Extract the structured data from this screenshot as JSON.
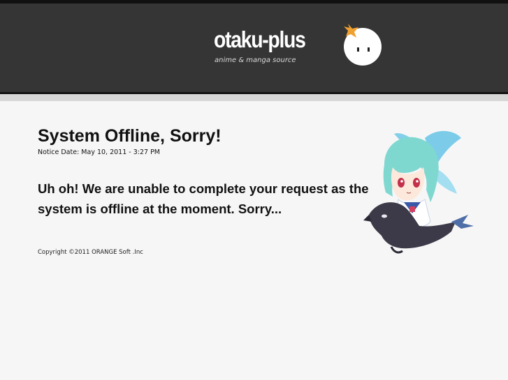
{
  "header": {
    "logo_text": "otaku-plus",
    "tagline": "anime & manga source",
    "mascot_icon": "blob-mascot-icon"
  },
  "notice": {
    "title": "System Offline, Sorry!",
    "date": "Notice Date: May 10, 2011 - 3:27 PM",
    "message": "Uh oh! We are unable to complete your request as the system is offline at the moment. Sorry..."
  },
  "footer": {
    "copyright": "Copyright ©2011 ORANGE Soft .Inc"
  },
  "illustration": {
    "icon": "anime-girl-riding-bird-illustration"
  },
  "colors": {
    "header_bg": "#353535",
    "page_bg": "#f6f6f6",
    "mascot_star": "#f0a030",
    "hair": "#7fd8d0",
    "bird": "#3c3a48"
  }
}
